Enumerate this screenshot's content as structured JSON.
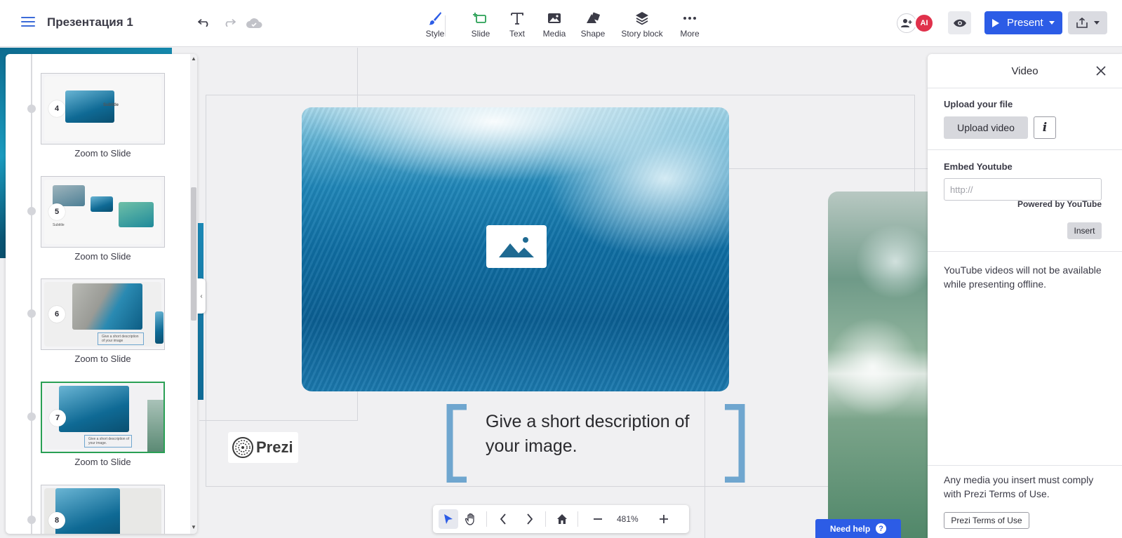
{
  "header": {
    "doc_title": "Презентация 1",
    "tools": [
      {
        "label": "Style",
        "icon": "brush-icon"
      },
      {
        "label": "Slide",
        "icon": "slide-add-icon"
      },
      {
        "label": "Text",
        "icon": "text-icon"
      },
      {
        "label": "Media",
        "icon": "image-icon"
      },
      {
        "label": "Shape",
        "icon": "shape-icon"
      },
      {
        "label": "Story block",
        "icon": "layers-icon"
      },
      {
        "label": "More",
        "icon": "more-dots-icon"
      }
    ],
    "avatar_initials": "AI",
    "present_label": "Present",
    "colors": {
      "accent": "#2c5ce6",
      "slide_icon": "#2aa055",
      "avatar": "#e0314b"
    }
  },
  "slides_panel": {
    "items": [
      {
        "number": "4",
        "label": "Zoom to Slide",
        "subtitle": "Subtitle"
      },
      {
        "number": "5",
        "label": "Zoom to Slide",
        "subtitle": "Subtitle"
      },
      {
        "number": "6",
        "label": "Zoom to Slide",
        "caption": "Give a short description of your image"
      },
      {
        "number": "7",
        "label": "Zoom to Slide",
        "caption": "Give a short description of your image.",
        "selected": true
      },
      {
        "number": "8",
        "label": ""
      }
    ]
  },
  "canvas": {
    "caption": "Give a short description of your image.",
    "logo_text": "Prezi"
  },
  "bottom_toolbar": {
    "zoom": "481%"
  },
  "need_help": "Need help",
  "video_panel": {
    "title": "Video",
    "upload_label": "Upload your file",
    "upload_button": "Upload video",
    "info_button": "i",
    "embed_label": "Embed Youtube",
    "embed_placeholder": "http://",
    "powered_by": "Powered by YouTube",
    "insert_button": "Insert",
    "offline_note": "YouTube videos will not be available while presenting offline.",
    "terms_note": "Any media you insert must comply with Prezi Terms of Use.",
    "terms_button": "Prezi Terms of Use"
  }
}
